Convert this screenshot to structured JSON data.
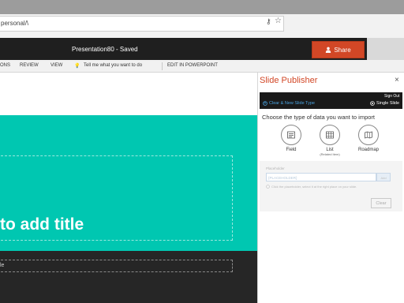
{
  "browser": {
    "address": "personal/\\"
  },
  "app": {
    "document_title": "Presentation80  -  Saved",
    "share_label": "Share"
  },
  "ribbon": {
    "items": [
      "ONS",
      "REVIEW",
      "VIEW",
      "Tell me what you want to do",
      "EDIT IN POWERPOINT"
    ]
  },
  "slide": {
    "title_text": "to add title",
    "subtitle_text": "le",
    "colors": {
      "accent": "#00c7b1",
      "dark": "#262626"
    }
  },
  "pane": {
    "title": "Slide Publisher",
    "close": "×",
    "sign_out": "Sign Out",
    "clear_new": "Clear & New Slide Type",
    "single_slide": "Single Slide",
    "choose_text": "Choose the type of data you want to import",
    "choices": [
      {
        "label": "Field",
        "sub": "",
        "icon": "document-icon"
      },
      {
        "label": "List",
        "sub": "(Related Item)",
        "icon": "grid-icon"
      },
      {
        "label": "Roadmap",
        "sub": "",
        "icon": "map-icon"
      }
    ],
    "property_label": "Placeholder",
    "property_placeholder": "{PLACEHOLDER}",
    "property_button": "Add",
    "property_hint": "Click the placeholder, select it at the right place on your slide.",
    "clear_label": "Clear",
    "accent_color": "#d24726"
  }
}
